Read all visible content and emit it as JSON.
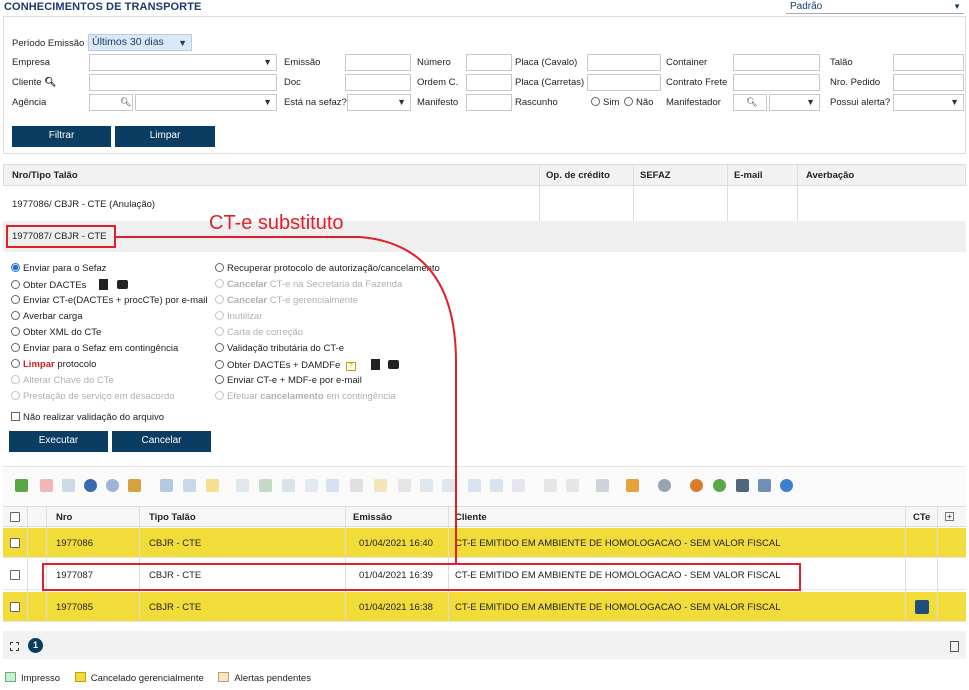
{
  "page_title": "CONHECIMENTOS DE TRANSPORTE",
  "view_select": "Padrão",
  "filters": {
    "periodo_label": "Período Emissão",
    "periodo_value": "Últimos 30 dias",
    "empresa": "Empresa",
    "emissao": "Emissão",
    "numero": "Número",
    "placa_cavalo": "Placa (Cavalo)",
    "container": "Container",
    "talao": "Talão",
    "cliente": "Cliente",
    "doc": "Doc",
    "ordem": "Ordem C.",
    "placa_carretas": "Placa (Carretas)",
    "contrato_frete": "Contrato Frete",
    "nro_pedido": "Nro. Pedido",
    "agencia": "Agência",
    "esta_sefaz": "Está na sefaz?",
    "manifesto": "Manifesto",
    "rascunho": "Rascunho",
    "sim": "Sim",
    "nao": "Não",
    "manifestador": "Manifestador",
    "possui_alerta": "Possui alerta?",
    "filtrar": "Filtrar",
    "limpar": "Limpar"
  },
  "top_table": {
    "headers": [
      "Nro/Tipo Talão",
      "Op. de crédito",
      "SEFAZ",
      "E-mail",
      "Averbação"
    ],
    "rows": [
      "1977086/ CBJR - CTE  (Anulação)",
      "1977087/ CBJR - CTE"
    ]
  },
  "annotation": "CT-e substituto",
  "actions_left": [
    "Enviar para o Sefaz",
    "Obter DACTEs",
    "Enviar CT-e(DACTEs + procCTe) por e-mail",
    "Averbar carga",
    "Obter XML do CTe",
    "Enviar para o Sefaz em contingência",
    "protocolo",
    "Alterar Chave do CTe",
    "Prestação de serviço em desacordo"
  ],
  "limpar_word": "Limpar",
  "actions_right": [
    "Recuperar protocolo de autorização/cancelamento",
    "CT-e na Secretaria da Fazenda",
    "CT-e gerencialmente",
    "Inutilizar",
    "Carta de correção",
    "Validação tributária do CT-e",
    "Obter DACTEs + DAMDFe",
    "Enviar CT-e + MDF-e por e-mail",
    "em contingência"
  ],
  "cancelar_word": "Cancelar",
  "efetuar_word": "Efetuar",
  "cancelamento_word": "cancelamento",
  "nao_validar": "Não realizar validação do arquivo",
  "executar": "Executar",
  "cancelar": "Cancelar",
  "grid": {
    "headers": [
      "Nro",
      "Tipo Talão",
      "Emissão",
      "Cliente",
      "CTe"
    ],
    "rows": [
      {
        "nro": "1977086",
        "tipo": "CBJR - CTE",
        "emissao": "01/04/2021 16:40",
        "cliente": "CT-E EMITIDO EM AMBIENTE DE HOMOLOGACAO - SEM VALOR FISCAL",
        "status": "cancelado"
      },
      {
        "nro": "1977087",
        "tipo": "CBJR - CTE",
        "emissao": "01/04/2021 16:39",
        "cliente": "CT-E EMITIDO EM AMBIENTE DE HOMOLOGACAO - SEM VALOR FISCAL",
        "status": "normal"
      },
      {
        "nro": "1977085",
        "tipo": "CBJR - CTE",
        "emissao": "01/04/2021 16:38",
        "cliente": "CT-E EMITIDO EM AMBIENTE DE HOMOLOGACAO - SEM VALOR FISCAL",
        "status": "cancelado"
      }
    ]
  },
  "page_number": "1",
  "legend": [
    "Impresso",
    "Cancelado gerencialmente",
    "Alertas pendentes"
  ],
  "colors": {
    "accent": "#0b3d63",
    "cancelado": "#f1dc3a",
    "impresso": "#c8efcf",
    "alerta": "#fbe6cc",
    "annotation": "#e0202a"
  }
}
